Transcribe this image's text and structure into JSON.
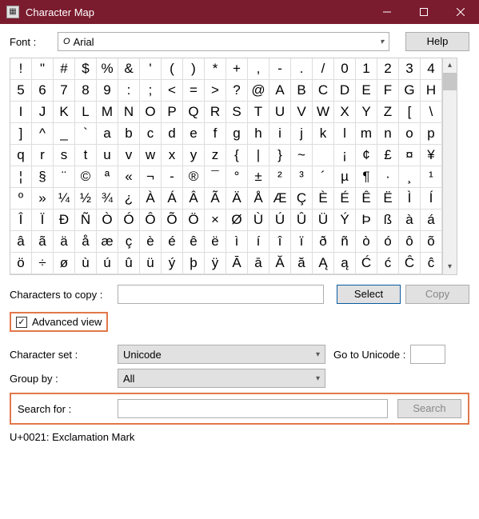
{
  "window": {
    "title": "Character Map"
  },
  "fontRow": {
    "label": "Font :",
    "value": "Arial",
    "help": "Help"
  },
  "grid": {
    "rows": [
      [
        "!",
        "\"",
        "#",
        "$",
        "%",
        "&",
        "'",
        "(",
        ")",
        "*",
        "+",
        ",",
        "-",
        ".",
        "/",
        "0",
        "1",
        "2",
        "3",
        "4"
      ],
      [
        "5",
        "6",
        "7",
        "8",
        "9",
        ":",
        ";",
        "<",
        "=",
        ">",
        "?",
        "@",
        "A",
        "B",
        "C",
        "D",
        "E",
        "F",
        "G",
        "H"
      ],
      [
        "I",
        "J",
        "K",
        "L",
        "M",
        "N",
        "O",
        "P",
        "Q",
        "R",
        "S",
        "T",
        "U",
        "V",
        "W",
        "X",
        "Y",
        "Z",
        "[",
        "\\"
      ],
      [
        "]",
        "^",
        "_",
        "`",
        "a",
        "b",
        "c",
        "d",
        "e",
        "f",
        "g",
        "h",
        "i",
        "j",
        "k",
        "l",
        "m",
        "n",
        "o",
        "p"
      ],
      [
        "q",
        "r",
        "s",
        "t",
        "u",
        "v",
        "w",
        "x",
        "y",
        "z",
        "{",
        "|",
        "}",
        "~",
        "",
        "¡",
        "¢",
        "£",
        "¤",
        "¥"
      ],
      [
        "¦",
        "§",
        "¨",
        "©",
        "ª",
        "«",
        "¬",
        "-",
        "®",
        "¯",
        "°",
        "±",
        "²",
        "³",
        "´",
        "µ",
        "¶",
        "·",
        "¸",
        "¹"
      ],
      [
        "º",
        "»",
        "¼",
        "½",
        "¾",
        "¿",
        "À",
        "Á",
        "Â",
        "Ã",
        "Ä",
        "Å",
        "Æ",
        "Ç",
        "È",
        "É",
        "Ê",
        "Ë",
        "Ì",
        "Í"
      ],
      [
        "Î",
        "Ï",
        "Ð",
        "Ñ",
        "Ò",
        "Ó",
        "Ô",
        "Õ",
        "Ö",
        "×",
        "Ø",
        "Ù",
        "Ú",
        "Û",
        "Ü",
        "Ý",
        "Þ",
        "ß",
        "à",
        "á"
      ],
      [
        "â",
        "ã",
        "ä",
        "å",
        "æ",
        "ç",
        "è",
        "é",
        "ê",
        "ë",
        "ì",
        "í",
        "î",
        "ï",
        "ð",
        "ñ",
        "ò",
        "ó",
        "ô",
        "õ"
      ],
      [
        "ö",
        "÷",
        "ø",
        "ù",
        "ú",
        "û",
        "ü",
        "ý",
        "þ",
        "ÿ",
        "Ā",
        "ā",
        "Ă",
        "ă",
        "Ą",
        "ą",
        "Ć",
        "ć",
        "Ĉ",
        "ĉ"
      ]
    ]
  },
  "copyRow": {
    "label": "Characters to copy :",
    "select": "Select",
    "copy": "Copy"
  },
  "advanced": {
    "label": "Advanced view",
    "checked": true
  },
  "charset": {
    "label": "Character set :",
    "value": "Unicode",
    "gotoLabel": "Go to Unicode :"
  },
  "groupby": {
    "label": "Group by :",
    "value": "All"
  },
  "search": {
    "label": "Search for :",
    "button": "Search"
  },
  "status": "U+0021: Exclamation Mark"
}
